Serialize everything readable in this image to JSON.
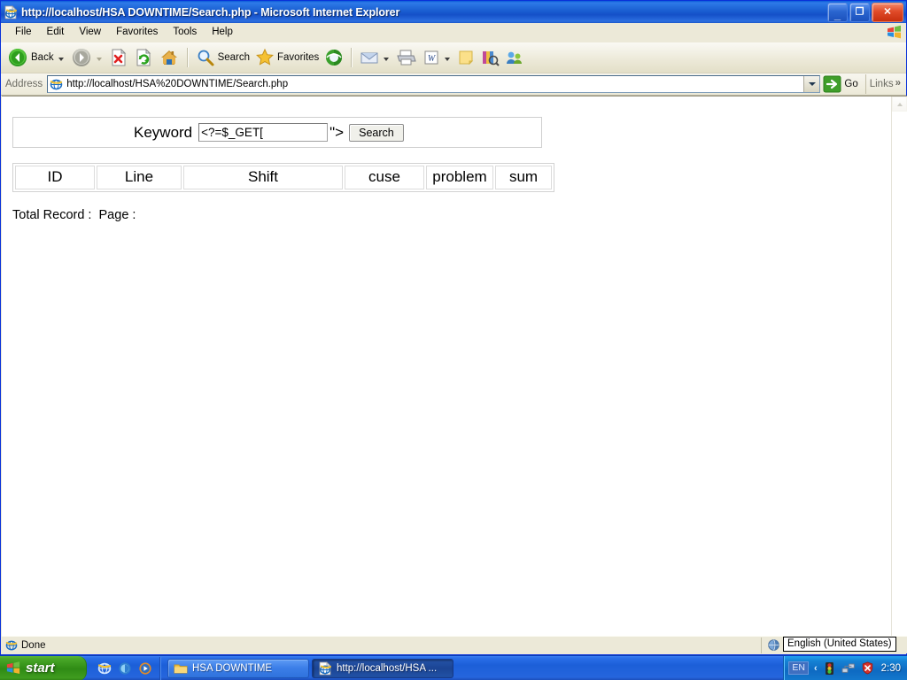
{
  "window": {
    "title": "http://localhost/HSA DOWNTIME/Search.php - Microsoft Internet Explorer",
    "icon": "ie-document-icon",
    "minimize_label": "_",
    "maximize_label": "❐",
    "close_label": "✕"
  },
  "menu": {
    "items": [
      {
        "label": "File"
      },
      {
        "label": "Edit"
      },
      {
        "label": "View"
      },
      {
        "label": "Favorites"
      },
      {
        "label": "Tools"
      },
      {
        "label": "Help"
      }
    ],
    "brand_icon": "windows-flag-icon"
  },
  "toolbar": {
    "back_label": "Back",
    "search_label": "Search",
    "favorites_label": "Favorites",
    "icons": [
      "back-icon",
      "forward-icon",
      "stop-icon",
      "refresh-icon",
      "home-icon",
      "search-icon",
      "favorites-icon",
      "media-icon",
      "mail-icon",
      "print-icon",
      "edit-word-icon",
      "notes-icon",
      "research-icon",
      "messenger-icon"
    ]
  },
  "address": {
    "label": "Address",
    "url": "http://localhost/HSA%20DOWNTIME/Search.php",
    "go_label": "Go",
    "links_label": "Links"
  },
  "page": {
    "form": {
      "keyword_label": "Keyword",
      "keyword_value": "<?=$_GET[",
      "keyword_placeholder": "",
      "raw_artifact": "\">",
      "search_button": "Search"
    },
    "table": {
      "columns": [
        {
          "label": "ID",
          "width": "88"
        },
        {
          "label": "Line",
          "width": "94"
        },
        {
          "label": "Shift",
          "width": "178"
        },
        {
          "label": "cuse",
          "width": "88"
        },
        {
          "label": "problem",
          "width": "74"
        },
        {
          "label": "sum",
          "width": "62"
        }
      ],
      "rows": []
    },
    "summary": "Total Record :  Page : "
  },
  "statusbar": {
    "status_text": "Done",
    "zone_icon": "internet-zone-icon",
    "language_tooltip": "English (United States)"
  },
  "taskbar": {
    "start_label": "start",
    "quicklaunch": [
      "ie-icon",
      "outlook-icon",
      "media-player-icon"
    ],
    "tasks": [
      {
        "label": "HSA DOWNTIME",
        "icon": "folder-icon",
        "active": false
      },
      {
        "label": "http://localhost/HSA ...",
        "icon": "ie-document-icon",
        "active": true
      }
    ],
    "tray": {
      "language": "EN",
      "chevron": "‹",
      "icons": [
        "traffic-light-icon",
        "network-icon",
        "security-shield-icon"
      ],
      "clock": "2:30"
    }
  },
  "colors": {
    "title_blue": "#1450c8",
    "taskbar_blue": "#1c5fd8",
    "start_green": "#2f8b15",
    "close_red": "#e04a28",
    "chrome_beige": "#ece9d8"
  }
}
